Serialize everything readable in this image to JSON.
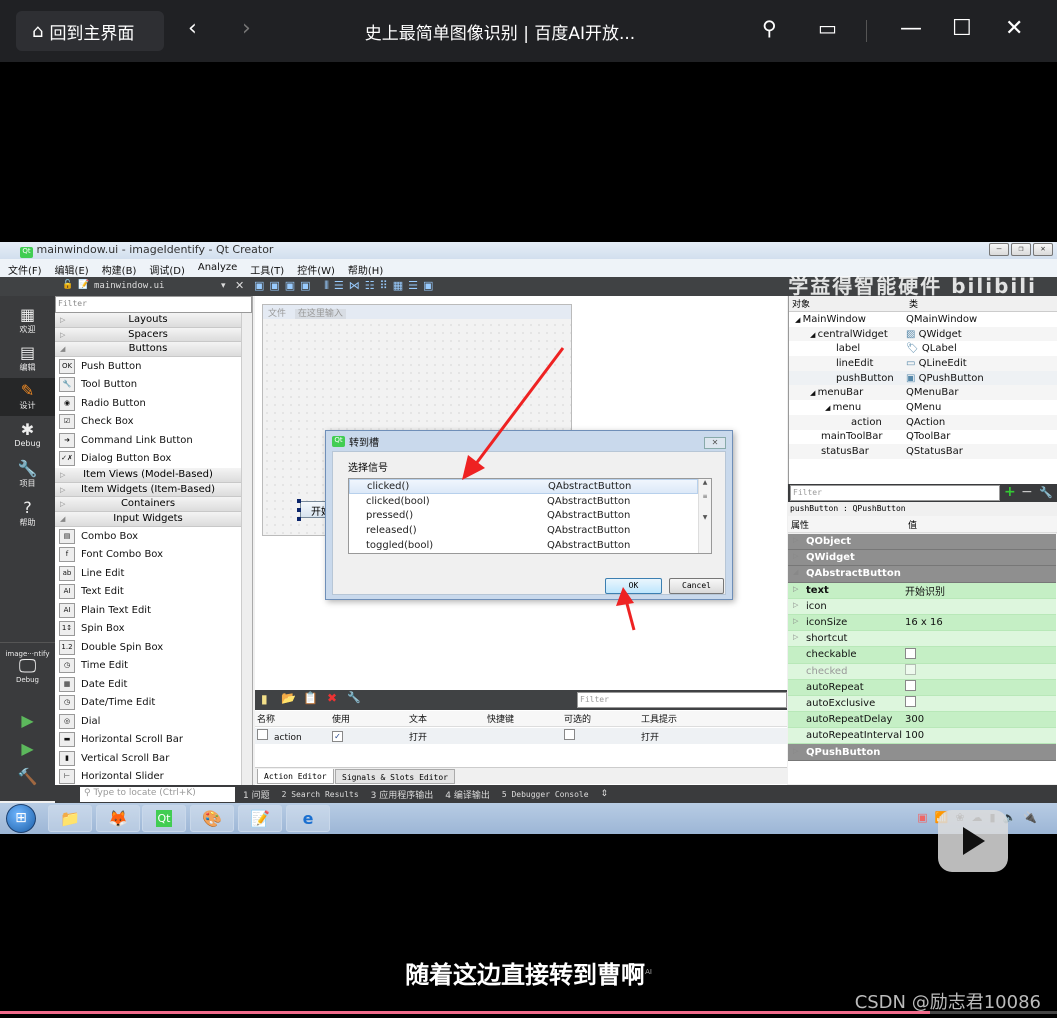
{
  "player": {
    "home_label": "回到主界面",
    "title": "史上最简单图像识别 | 百度AI开放...",
    "icons": [
      "home-icon",
      "back-icon",
      "forward-icon",
      "pin-icon",
      "pip-icon",
      "minimize-icon",
      "maximize-icon",
      "close-icon"
    ],
    "subtitle": "随着这边直接转到曹啊",
    "subtitle_badge": "AI",
    "watermark": "CSDN @励志君10086",
    "progress_percent": 88,
    "progress_color": "#f16b8b"
  },
  "qt": {
    "window_title": "mainwindow.ui - imageIdentify - Qt Creator",
    "channel_watermark": "学益得智能硬件 bilibili",
    "menu": [
      "文件(F)",
      "编辑(E)",
      "构建(B)",
      "调试(D)",
      "Analyze",
      "工具(T)",
      "控件(W)",
      "帮助(H)"
    ],
    "open_file": "mainwindow.ui",
    "modes": [
      "欢迎",
      "编辑",
      "设计",
      "Debug",
      "项目",
      "帮助"
    ],
    "active_mode": "设计",
    "kit": {
      "project": "image···ntify",
      "build": "Debug"
    },
    "widget_box": {
      "filter_placeholder": "Filter",
      "groups": [
        {
          "name": "Layouts",
          "expanded": false,
          "items": []
        },
        {
          "name": "Spacers",
          "expanded": false,
          "items": []
        },
        {
          "name": "Buttons",
          "expanded": true,
          "items": [
            "Push Button",
            "Tool Button",
            "Radio Button",
            "Check Box",
            "Command Link Button",
            "Dialog Button Box"
          ]
        },
        {
          "name": "Item Views (Model-Based)",
          "expanded": false,
          "items": []
        },
        {
          "name": "Item Widgets (Item-Based)",
          "expanded": false,
          "items": []
        },
        {
          "name": "Containers",
          "expanded": false,
          "items": []
        },
        {
          "name": "Input Widgets",
          "expanded": true,
          "items": [
            "Combo Box",
            "Font Combo Box",
            "Line Edit",
            "Text Edit",
            "Plain Text Edit",
            "Spin Box",
            "Double Spin Box",
            "Time Edit",
            "Date Edit",
            "Date/Time Edit",
            "Dial",
            "Horizontal Scroll Bar",
            "Vertical Scroll Bar",
            "Horizontal Slider"
          ]
        }
      ]
    },
    "form": {
      "menu_file": "文件",
      "menu_placeholder": "在这里输入",
      "button_text": "开始识"
    },
    "dialog": {
      "title": "转到槽",
      "label": "选择信号",
      "signals": [
        {
          "name": "clicked()",
          "class": "QAbstractButton",
          "selected": true
        },
        {
          "name": "clicked(bool)",
          "class": "QAbstractButton"
        },
        {
          "name": "pressed()",
          "class": "QAbstractButton"
        },
        {
          "name": "released()",
          "class": "QAbstractButton"
        },
        {
          "name": "toggled(bool)",
          "class": "QAbstractButton"
        }
      ],
      "ok": "OK",
      "cancel": "Cancel"
    },
    "object_inspector": {
      "headers": [
        "对象",
        "类"
      ],
      "rows": [
        {
          "name": "MainWindow",
          "class": "QMainWindow",
          "depth": 0,
          "expanded": true
        },
        {
          "name": "centralWidget",
          "class": "QWidget",
          "depth": 1,
          "expanded": true
        },
        {
          "name": "label",
          "class": "QLabel",
          "depth": 2
        },
        {
          "name": "lineEdit",
          "class": "QLineEdit",
          "depth": 2
        },
        {
          "name": "pushButton",
          "class": "QPushButton",
          "depth": 2,
          "selected": true
        },
        {
          "name": "menuBar",
          "class": "QMenuBar",
          "depth": 1,
          "expanded": true
        },
        {
          "name": "menu",
          "class": "QMenu",
          "depth": 2,
          "expanded": true
        },
        {
          "name": "action",
          "class": "QAction",
          "depth": 3
        },
        {
          "name": "mainToolBar",
          "class": "QToolBar",
          "depth": 1
        },
        {
          "name": "statusBar",
          "class": "QStatusBar",
          "depth": 1
        }
      ]
    },
    "property_editor": {
      "filter_placeholder": "Filter",
      "object_class": "pushButton : QPushButton",
      "headers": [
        "属性",
        "值"
      ],
      "rows": [
        {
          "name": "QObject",
          "group": true
        },
        {
          "name": "QWidget",
          "group": true
        },
        {
          "name": "QAbstractButton",
          "group": true,
          "expanded": true
        },
        {
          "name": "text",
          "value": "开始识别",
          "bold": true,
          "expandable": true
        },
        {
          "name": "icon",
          "value": "",
          "expandable": true
        },
        {
          "name": "iconSize",
          "value": "16 x 16",
          "expandable": true
        },
        {
          "name": "shortcut",
          "value": "",
          "expandable": true
        },
        {
          "name": "checkable",
          "checkbox": false
        },
        {
          "name": "checked",
          "checkbox": false,
          "disabled": true
        },
        {
          "name": "autoRepeat",
          "checkbox": false
        },
        {
          "name": "autoExclusive",
          "checkbox": false
        },
        {
          "name": "autoRepeatDelay",
          "value": "300"
        },
        {
          "name": "autoRepeatInterval",
          "value": "100"
        },
        {
          "name": "QPushButton",
          "group": true
        }
      ]
    },
    "action_editor": {
      "filter_placeholder": "Filter",
      "headers": [
        "名称",
        "使用",
        "文本",
        "快捷键",
        "可选的",
        "工具提示"
      ],
      "rows": [
        {
          "name": "action",
          "used": true,
          "text": "打开",
          "shortcut": "",
          "checkable": false,
          "tooltip": "打开"
        }
      ],
      "tabs": [
        "Action Editor",
        "Signals & Slots Editor"
      ],
      "active_tab": "Action Editor"
    },
    "output_bar": {
      "locate_placeholder": "Type to locate (Ctrl+K)",
      "panes": [
        "1 问题",
        "2 Search Results",
        "3 应用程序输出",
        "4 编译输出",
        "5 Debugger Console"
      ]
    },
    "taskbar": {
      "apps": [
        "explorer",
        "firefox",
        "qt-creator",
        "paint",
        "notepad-editor",
        "internet-explorer"
      ]
    }
  }
}
